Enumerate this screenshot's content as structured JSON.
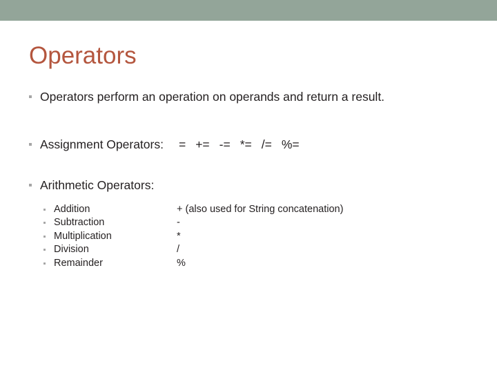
{
  "theme": {
    "band_color": "#93a599",
    "title_color": "#b4563e",
    "body_color": "#231f20",
    "bullet_color": "#a6a6a6",
    "background": "#ffffff"
  },
  "slide": {
    "title": "Operators",
    "intro_bullet": "Operators perform an operation on operands and return a result.",
    "assignment": {
      "label": "Assignment Operators:",
      "operators": [
        "=",
        "+=",
        "-=",
        "*=",
        "/=",
        "%="
      ]
    },
    "arithmetic": {
      "label": "Arithmetic Operators:",
      "rows": [
        {
          "name": "Addition",
          "symbol": "+ (also used for String concatenation)"
        },
        {
          "name": "Subtraction",
          "symbol": "-"
        },
        {
          "name": "Multiplication",
          "symbol": "*"
        },
        {
          "name": "Division",
          "symbol": "/"
        },
        {
          "name": "Remainder",
          "symbol": "%"
        }
      ]
    }
  }
}
